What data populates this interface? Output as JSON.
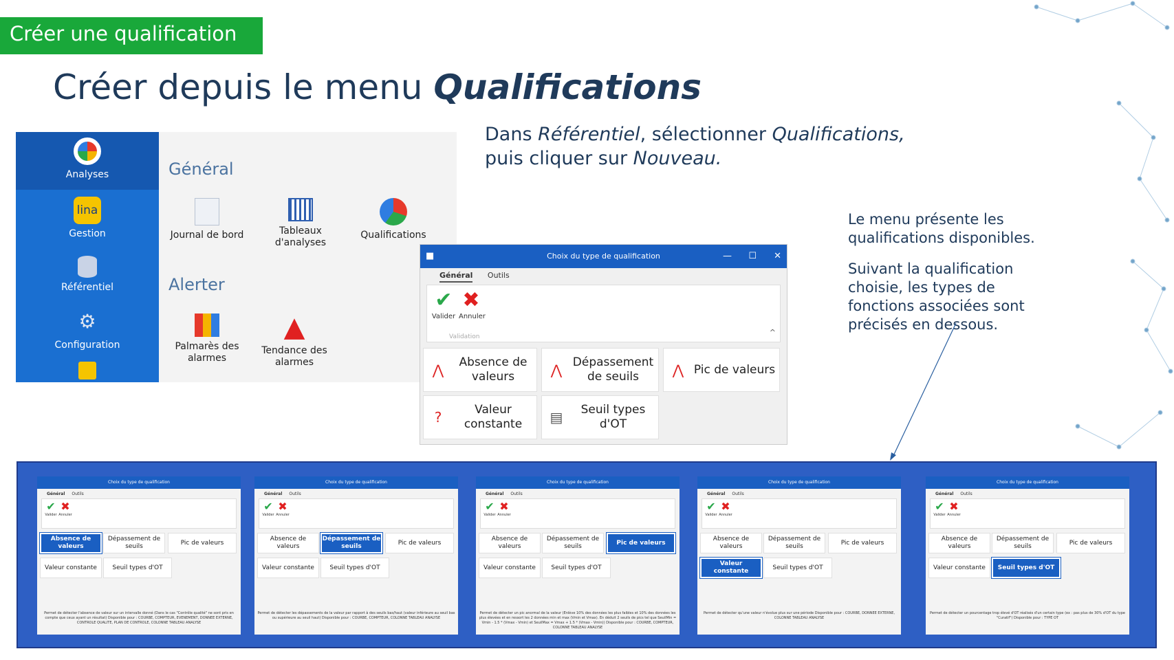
{
  "slide": {
    "badge": "Créer une qualification",
    "heading_prefix": "Créer depuis le menu ",
    "heading_emph": "Qualifications",
    "intro": {
      "p1": "Dans ",
      "p1_i1": "Référentiel",
      "p2": ", sélectionner ",
      "p2_i2": "Qualifications,",
      "p3": "puis cliquer sur ",
      "p3_i3": "Nouveau."
    },
    "side_1": "Le menu présente les qualifications disponibles.",
    "side_2": "Suivant la qualification choisie, les types de fonctions associées sont précisés en dessous."
  },
  "app_menu": {
    "items": [
      {
        "label": "Analyses",
        "icon": "analyses-icon"
      },
      {
        "label": "Gestion",
        "icon": "lina-icon",
        "icon_text": "lina"
      },
      {
        "label": "Référentiel",
        "icon": "database-icon"
      },
      {
        "label": "Configuration",
        "icon": "gears-icon"
      }
    ]
  },
  "menu_panel": {
    "general_title": "Général",
    "general_items": [
      "Journal de bord",
      "Tableaux d'analyses",
      "Qualifications"
    ],
    "alert_title": "Alerter",
    "alert_items": [
      "Palmarès des alarmes",
      "Tendance des alarmes"
    ]
  },
  "dialog": {
    "title": "Choix du type de qualification",
    "tabs": [
      "Général",
      "Outils"
    ],
    "validate": "Valider",
    "cancel": "Annuler",
    "group_label": "Validation",
    "tiles": [
      "Absence de valeurs",
      "Dépassement de seuils",
      "Pic de valeurs",
      "Valeur constante",
      "Seuil types d'OT"
    ]
  },
  "mini_dialogs": [
    {
      "selected": 0,
      "desc": "Permet de détecter l'absence de valeur sur un intervalle donné (Dans le cas \"Contrôle qualité\" ne sont pris en compte que ceux ayant un résultat) Disponible pour : COURBE, COMPTEUR, EVENEMENT, DONNEE EXTERNE, CONTROLE QUALITE, PLAN DE CONTROLE, COLONNE TABLEAU ANALYSE"
    },
    {
      "selected": 1,
      "desc": "Permet de détecter les dépassements de la valeur par rapport à des seuils bas/haut (valeur inférieure au seuil bas ou supérieure au seuil haut) Disponible pour : COURBE, COMPTEUR, COLONNE TABLEAU ANALYSE"
    },
    {
      "selected": 2,
      "desc": "Permet de détecter un pic anormal de la valeur (Enlève 10% des données les plus faibles et 10% des données les plus élevées et en ressort les 2 données min et max (Vmin et Vmax). En déduit 2 seuils de pics tel que SeuilMin = Vmin - 1.5 * (Vmax - Vmin) et SeuilMax = Vmax + 1.5 * (Vmax - Vmin)) Disponible pour : COURBE, COMPTEUR, COLONNE TABLEAU ANALYSE"
    },
    {
      "selected": 3,
      "desc": "Permet de détecter qu'une valeur n'évolue plus sur une période Disponible pour : COURBE, DONNEE EXTERNE, COLONNE TABLEAU ANALYSE"
    },
    {
      "selected": 4,
      "desc": "Permet de détecter un pourcentage trop élevé d'OT réalisés d'un certain type (ex : pas plus de 30% d'OT du type \"Curatif\") Disponible pour : TYPE OT"
    }
  ],
  "colors": {
    "badge": "#19a83a",
    "blue": "#1a6fd1",
    "dialog_title": "#1a5fc2",
    "strip": "#2e5fc4",
    "text": "#1f3a5a"
  }
}
